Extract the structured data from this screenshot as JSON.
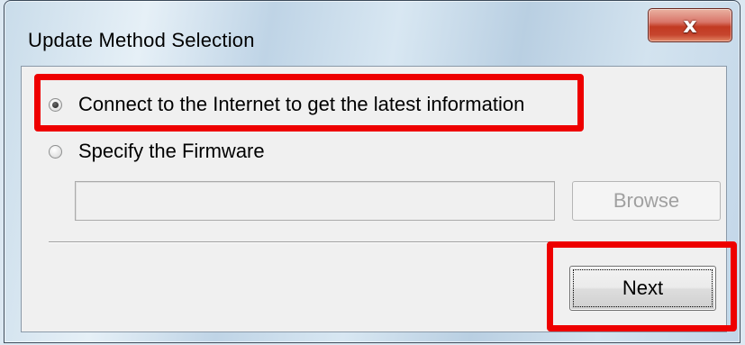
{
  "window": {
    "title": "Update Method Selection",
    "close_icon": "close-icon",
    "close_glyph": "x"
  },
  "options": [
    {
      "label": "Connect to the Internet to get the latest information",
      "checked": true
    },
    {
      "label": "Specify the Firmware",
      "checked": false
    }
  ],
  "firmware_path": {
    "value": "",
    "enabled": false
  },
  "buttons": {
    "browse_label": "Browse",
    "next_label": "Next"
  },
  "annotations": {
    "highlight_color": "#ee0000"
  }
}
